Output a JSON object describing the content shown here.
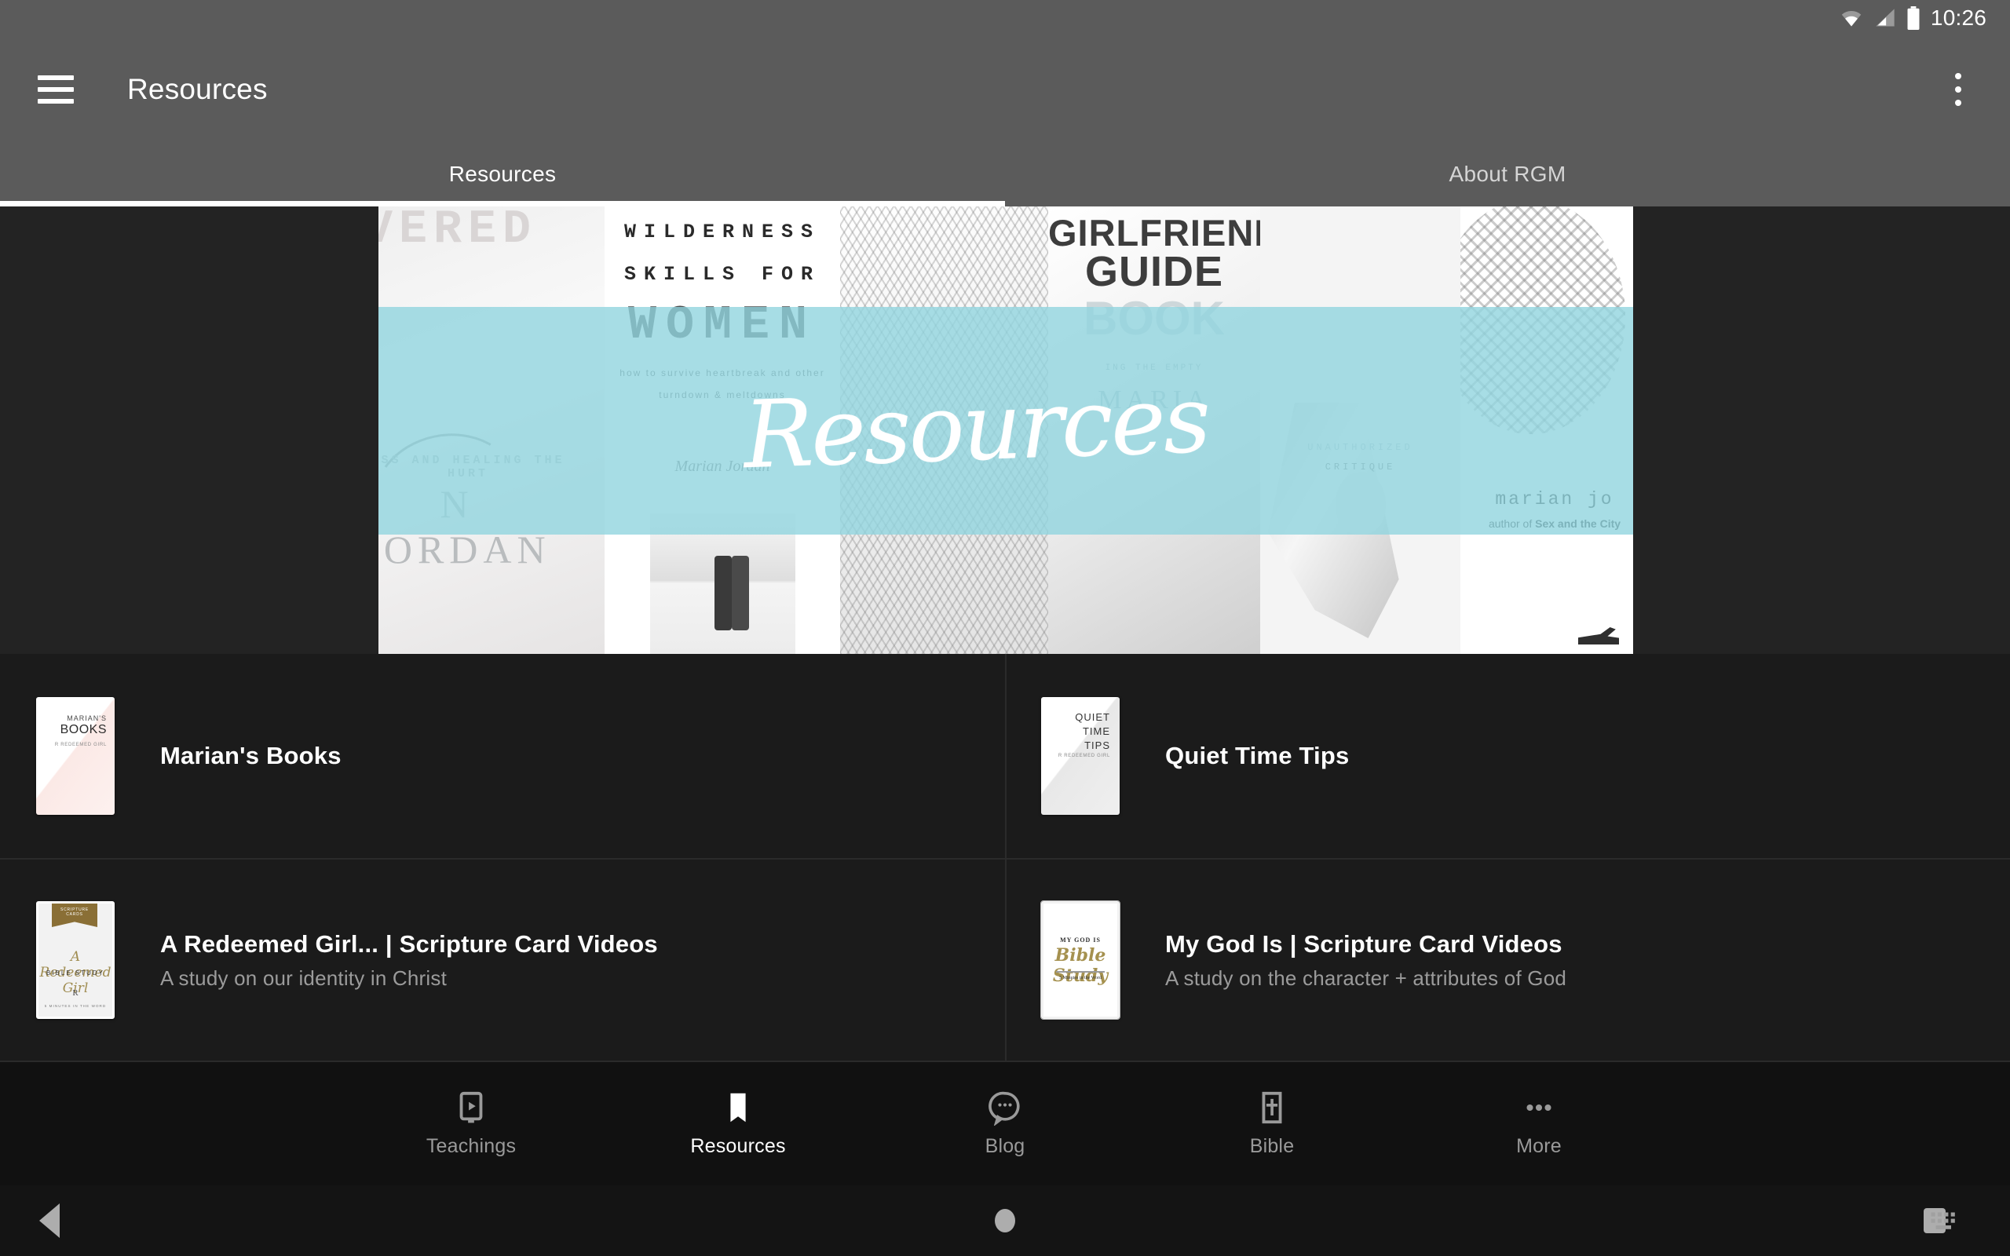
{
  "status_bar": {
    "time": "10:26",
    "icons": [
      "wifi-icon",
      "cellular-signal-icon",
      "battery-icon"
    ]
  },
  "app_bar": {
    "menu_icon": "hamburger-menu-icon",
    "title": "Resources",
    "overflow_icon": "more-vertical-icon"
  },
  "tabs": [
    {
      "label": "Resources",
      "active": true
    },
    {
      "label": "About RGM",
      "active": false
    }
  ],
  "hero": {
    "banner_word": "Resources",
    "banner_color": "#91d4de",
    "collage_texts": {
      "cover1_title": "VERED",
      "cover1_sub": "ESS AND HEALING THE HURT",
      "cover1_author": "N JORDAN",
      "cover2_line1": "WILDERNESS",
      "cover2_line2": "SKILLS FOR",
      "cover2_line3": "WOMEN",
      "cover2_sub1": "how to survive heartbreak and other",
      "cover2_sub2": "turndown & meltdowns",
      "cover2_author": "Marian Jordan",
      "cover4_line1": "GIRLFRIENDS",
      "cover4_line2": "GUIDE",
      "cover4_line3": "BOOK",
      "cover4_sub": "ING THE EMPTY",
      "cover4_name": "MARIA",
      "cover5_line1": "UNAUTHORIZED",
      "cover5_line2": "CRITIQUE",
      "cover6_name": "marian jo",
      "cover6_author": "author of Sex and the City",
      "cover6_author_bold": "Sex and the City"
    }
  },
  "resources": [
    {
      "title": "Marian's Books",
      "subtitle": "",
      "thumb": "marians-books-cover",
      "thumb_text": {
        "a": "MARIAN'S",
        "b": "BOOKS",
        "c": "R  REDEEMED GIRL"
      }
    },
    {
      "title": "Quiet Time Tips",
      "subtitle": "",
      "thumb": "quiet-time-tips-cover",
      "thumb_text": {
        "a": "QUIET",
        "b": "TIME",
        "c": "TIPS",
        "d": "R  REDEEMED GIRL"
      }
    },
    {
      "title": "A Redeemed Girl... | Scripture Card Videos",
      "subtitle": "A study on our identity in Christ",
      "thumb": "a-redeemed-girl-cover",
      "thumb_text": {
        "ribbon": "SCRIPTURE CARDS",
        "a": "A Redeemed Girl",
        "b": "BIBLE STUDY",
        "c": "R",
        "d": "5 MINUTES IN THE WORD"
      }
    },
    {
      "title": "My God Is | Scripture Card Videos",
      "subtitle": "A study on the character + attributes of God",
      "thumb": "my-god-is-cover",
      "thumb_text": {
        "a": "MY GOD IS",
        "b": "Bible Study",
        "c": "5 Minutes in the Word"
      }
    }
  ],
  "bottom_nav": [
    {
      "label": "Teachings",
      "icon": "video-player-icon",
      "active": false
    },
    {
      "label": "Resources",
      "icon": "book-icon",
      "active": true
    },
    {
      "label": "Blog",
      "icon": "chat-bubble-icon",
      "active": false
    },
    {
      "label": "Bible",
      "icon": "bible-cross-icon",
      "active": false
    },
    {
      "label": "More",
      "icon": "more-horizontal-icon",
      "active": false
    }
  ],
  "system_nav": {
    "back": "back-triangle-icon",
    "home": "home-circle-icon",
    "recents": "recents-square-icon",
    "keyboard": "keyboard-switcher-icon"
  }
}
